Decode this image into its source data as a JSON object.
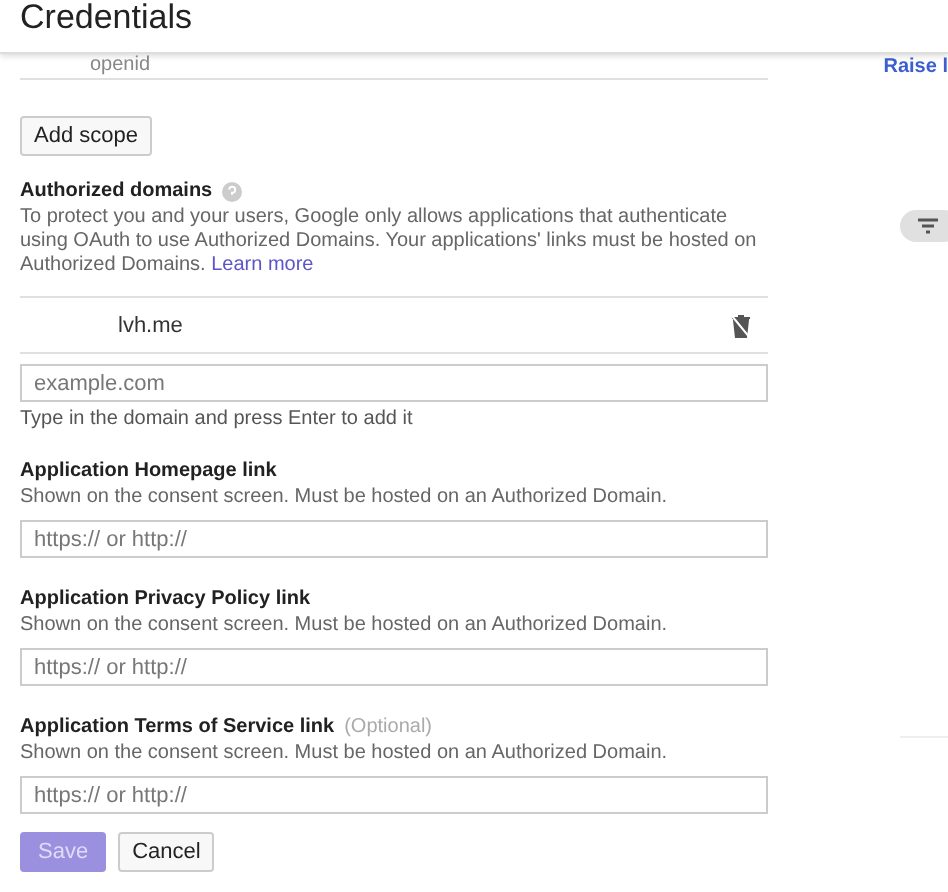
{
  "header": {
    "title": "Credentials"
  },
  "scopes": [
    {
      "name": "openid"
    }
  ],
  "side_link": "Raise l",
  "add_scope_button": "Add scope",
  "authorized_domains": {
    "title": "Authorized domains",
    "description": "To protect you and your users, Google only allows applications that authenticate using OAuth to use Authorized Domains. Your applications' links must be hosted on Authorized Domains.",
    "learn_more": "Learn more",
    "domains": [
      {
        "name": "lvh.me"
      }
    ],
    "input": {
      "placeholder": "example.com"
    },
    "hint": "Type in the domain and press Enter to add it"
  },
  "links": [
    {
      "label": "Application Homepage link",
      "description": "Shown on the consent screen. Must be hosted on an Authorized Domain.",
      "placeholder": "https:// or http://"
    },
    {
      "label": "Application Privacy Policy link",
      "description": "Shown on the consent screen. Must be hosted on an Authorized Domain.",
      "placeholder": "https:// or http://"
    },
    {
      "label": "Application Terms of Service link",
      "optional": "(Optional)",
      "description": "Shown on the consent screen. Must be hosted on an Authorized Domain.",
      "placeholder": "https:// or http://"
    }
  ],
  "buttons": [
    {
      "label": "Save",
      "kind": "primary",
      "disabled": true
    },
    {
      "label": "Cancel",
      "kind": "secondary",
      "disabled": false
    }
  ]
}
